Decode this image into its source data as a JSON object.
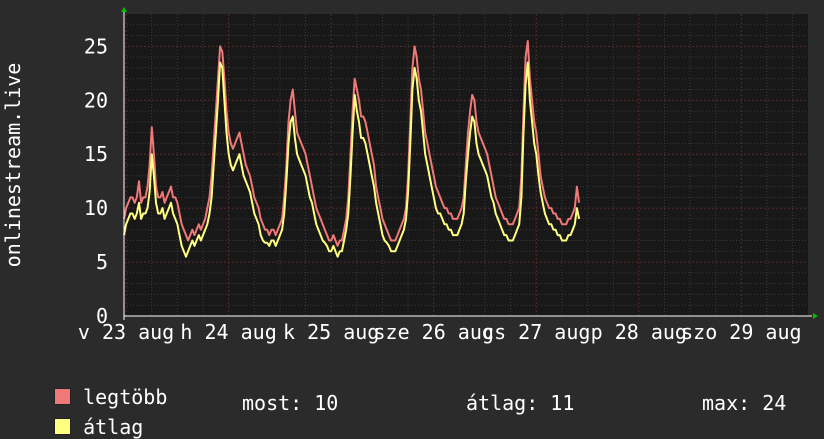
{
  "colors": {
    "background": "#2b2b2b",
    "plot_background": "#181818",
    "grid_major": "#5a2a2a",
    "grid_minor": "#3a3a3a",
    "series_max": "#f07878",
    "series_avg": "#ffff80",
    "axis_arrow": "#00c000"
  },
  "legend": {
    "max_label": "legtöbb",
    "avg_label": "átlag"
  },
  "stats": {
    "now_label": "most:",
    "now_value": "10",
    "avg_label": "átlag:",
    "avg_value": "11",
    "max_label": "max:",
    "max_value": "24"
  },
  "chart_data": {
    "type": "line",
    "title": "",
    "ylabel": "onlinestream.live",
    "xlabel": "",
    "ylim": [
      0,
      28
    ],
    "yticks": [
      0,
      5,
      10,
      15,
      20,
      25
    ],
    "grid": true,
    "xticks": [
      "v 23 aug",
      "h 24 aug",
      "k 25 aug",
      "sze 26 aug",
      "cs 27 aug",
      "p 28 aug",
      "szo 29 aug"
    ],
    "xtick_offsets": [
      0,
      1,
      2,
      3,
      4,
      5,
      6
    ],
    "x_range_days": [
      -0.02,
      6.65
    ],
    "samples_per_day": 48,
    "series": [
      {
        "name": "legtöbb",
        "color": "#f07878",
        "values": [
          9,
          10,
          10.5,
          11,
          11,
          10.5,
          11,
          12.5,
          10.5,
          11,
          11,
          12,
          14,
          17.5,
          15,
          12,
          11,
          11,
          11.5,
          10.5,
          11,
          11.5,
          12,
          11,
          11,
          10.5,
          9.5,
          8.5,
          8,
          7.5,
          7,
          7.5,
          8,
          7.5,
          8,
          8.5,
          8,
          8.5,
          9,
          10,
          11,
          13,
          16,
          19,
          22,
          25,
          24.5,
          22,
          19,
          17,
          16,
          15.5,
          16,
          16.5,
          17,
          16,
          15,
          14,
          13.5,
          13,
          12,
          11,
          10.5,
          10,
          9,
          8.5,
          8,
          8,
          7.5,
          8,
          8,
          7.5,
          8,
          8.5,
          9,
          11,
          14,
          18,
          20,
          21,
          19,
          17,
          16.5,
          16,
          15.5,
          15,
          14,
          13,
          12,
          11,
          10,
          9.5,
          9,
          8.5,
          8,
          7.5,
          7,
          7,
          7.5,
          7,
          6.5,
          7,
          7,
          8,
          9,
          11,
          15,
          19,
          22,
          21,
          20,
          18.5,
          18.5,
          18,
          17,
          16,
          15,
          14,
          12,
          11,
          10,
          9,
          8.5,
          8,
          7.5,
          7,
          7,
          7,
          7.5,
          8,
          8.5,
          9,
          10,
          13,
          18,
          23,
          25,
          24,
          22,
          21,
          19,
          17,
          16,
          15,
          14,
          13,
          12,
          11.5,
          11,
          10.5,
          10,
          10,
          9.5,
          9.5,
          9,
          9,
          9,
          9.5,
          10,
          11,
          14,
          17,
          19,
          20.5,
          20,
          18,
          17,
          16.5,
          16,
          15.5,
          15,
          14,
          13,
          12,
          11,
          10.5,
          10,
          9.5,
          9,
          9,
          8.5,
          8.5,
          8.5,
          9,
          9.5,
          10,
          13,
          19,
          24,
          25.5,
          22,
          20,
          18,
          17,
          15,
          13,
          12,
          11,
          10.5,
          10,
          10,
          9.5,
          9.5,
          9,
          9,
          8.5,
          8.5,
          8.5,
          9,
          9,
          9.5,
          10,
          12,
          10.5
        ]
      },
      {
        "name": "átlag",
        "color": "#ffff80",
        "values": [
          7.5,
          8.5,
          9,
          9.5,
          9.5,
          9,
          9.5,
          10.5,
          9,
          9.5,
          9.5,
          10,
          11.5,
          15,
          13,
          10.5,
          9.5,
          9.5,
          10,
          9,
          9.5,
          10,
          10.5,
          9.5,
          9,
          8.5,
          7.5,
          6.5,
          6,
          5.5,
          6,
          6.5,
          7,
          6.5,
          7,
          7.5,
          7,
          7.5,
          8,
          8.5,
          9.5,
          11,
          14,
          17,
          20,
          23.5,
          23,
          20,
          17,
          15,
          14,
          13.5,
          14,
          14.5,
          15,
          14,
          13,
          12.5,
          12,
          11.5,
          10.5,
          9.5,
          9,
          8.5,
          7.5,
          7,
          6.8,
          6.8,
          6.5,
          7,
          7,
          6.5,
          7,
          7.5,
          8,
          9.5,
          12.5,
          16,
          18,
          18.5,
          16.5,
          15,
          14.5,
          14,
          13.5,
          13,
          12,
          11,
          10.5,
          9.5,
          8.5,
          8,
          7.5,
          7,
          6.8,
          6.5,
          6,
          6,
          6.5,
          6,
          5.5,
          6,
          6,
          7,
          8,
          9.5,
          13,
          17,
          20.5,
          19,
          18,
          16.5,
          16.5,
          16,
          15,
          14,
          13,
          12,
          10.5,
          9.5,
          8.5,
          7.5,
          7,
          6.8,
          6.5,
          6,
          6,
          6,
          6.5,
          7,
          7.5,
          8,
          9,
          11.5,
          16,
          21,
          23,
          22,
          20,
          19,
          17,
          15,
          14,
          13,
          12,
          11,
          10,
          9.5,
          9.5,
          9,
          8.5,
          8.5,
          8,
          8,
          7.5,
          7.5,
          7.5,
          8,
          8.5,
          9.5,
          12.5,
          15,
          17,
          18.5,
          18,
          16,
          15,
          14.5,
          14,
          13.5,
          13,
          12,
          11,
          10.5,
          9.5,
          9,
          8.5,
          8,
          7.5,
          7.5,
          7,
          7,
          7,
          7.5,
          8,
          8.5,
          11,
          17,
          21.5,
          23.5,
          20,
          18,
          16,
          15,
          13,
          11.5,
          10.5,
          9.5,
          9,
          8.5,
          8.5,
          8,
          8,
          7.5,
          7.5,
          7,
          7,
          7,
          7.5,
          7.5,
          8,
          8.5,
          10,
          9
        ]
      }
    ]
  }
}
